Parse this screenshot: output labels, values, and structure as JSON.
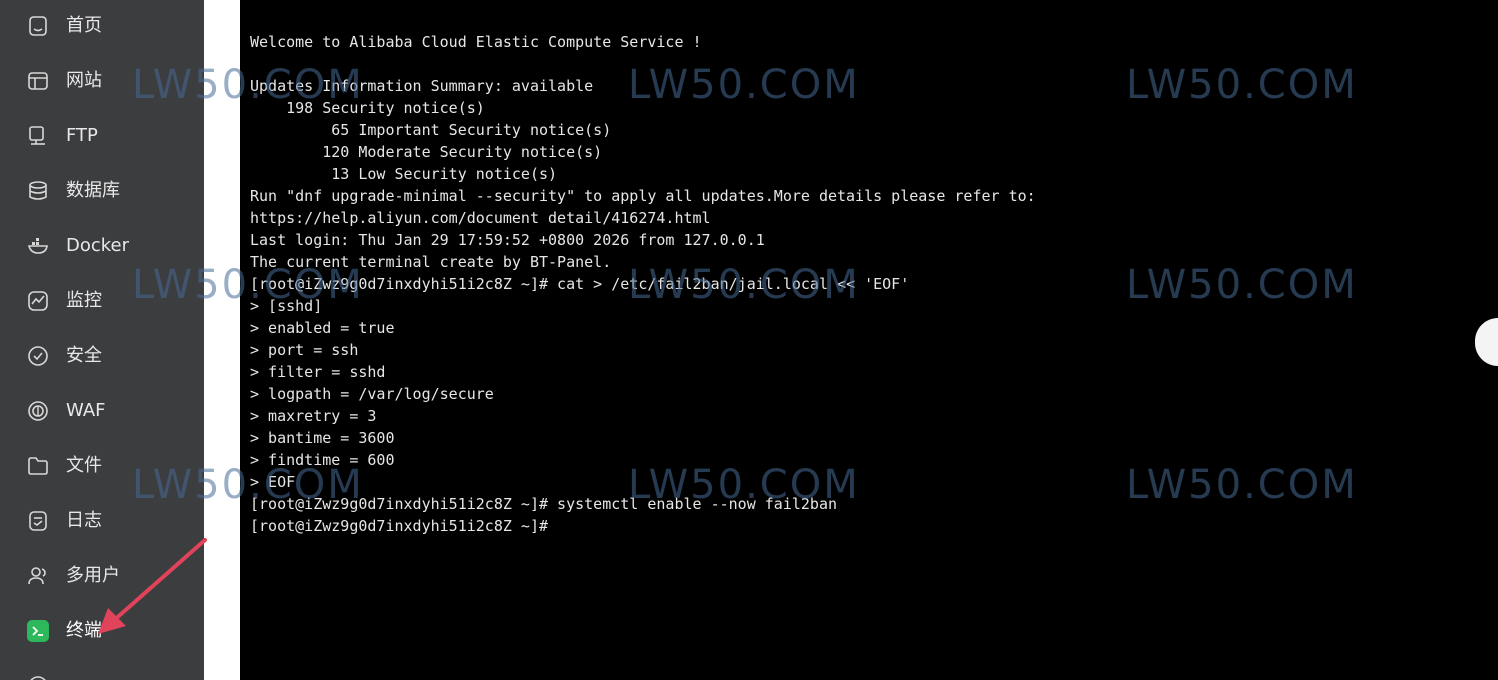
{
  "sidebar": {
    "items": [
      {
        "label": "首页",
        "icon": "home-icon"
      },
      {
        "label": "网站",
        "icon": "website-icon"
      },
      {
        "label": "FTP",
        "icon": "ftp-icon"
      },
      {
        "label": "数据库",
        "icon": "database-icon"
      },
      {
        "label": "Docker",
        "icon": "docker-icon"
      },
      {
        "label": "监控",
        "icon": "monitor-icon"
      },
      {
        "label": "安全",
        "icon": "security-icon"
      },
      {
        "label": "WAF",
        "icon": "waf-icon"
      },
      {
        "label": "文件",
        "icon": "folder-icon"
      },
      {
        "label": "日志",
        "icon": "log-icon"
      },
      {
        "label": "多用户",
        "icon": "users-icon"
      },
      {
        "label": "终端",
        "icon": "terminal-icon",
        "active": true,
        "accent": "#2eb85c"
      }
    ]
  },
  "terminal": {
    "lines": [
      "Welcome to Alibaba Cloud Elastic Compute Service !",
      "",
      "Updates Information Summary: available",
      "    198 Security notice(s)",
      "         65 Important Security notice(s)",
      "        120 Moderate Security notice(s)",
      "         13 Low Security notice(s)",
      "Run \"dnf upgrade-minimal --security\" to apply all updates.More details please refer to:",
      "https://help.aliyun.com/document detail/416274.html",
      "Last login: Thu Jan 29 17:59:52 +0800 2026 from 127.0.0.1",
      "The current terminal create by BT-Panel.",
      "[root@iZwz9g0d7inxdyhi51i2c8Z ~]# cat > /etc/fail2ban/jail.local << 'EOF'",
      "> [sshd]",
      "> enabled = true",
      "> port = ssh",
      "> filter = sshd",
      "> logpath = /var/log/secure",
      "> maxretry = 3",
      "> bantime = 3600",
      "> findtime = 600",
      "> EOF",
      "[root@iZwz9g0d7inxdyhi51i2c8Z ~]# systemctl enable --now fail2ban",
      "[root@iZwz9g0d7inxdyhi51i2c8Z ~]#"
    ]
  },
  "watermark": {
    "text": "LW50.COM",
    "color": "#466996"
  },
  "colors": {
    "sidebar_bg": "#3c3d3f",
    "terminal_bg": "#000000",
    "terminal_fg": "#e6e6e6",
    "arrow": "#e0435a"
  }
}
